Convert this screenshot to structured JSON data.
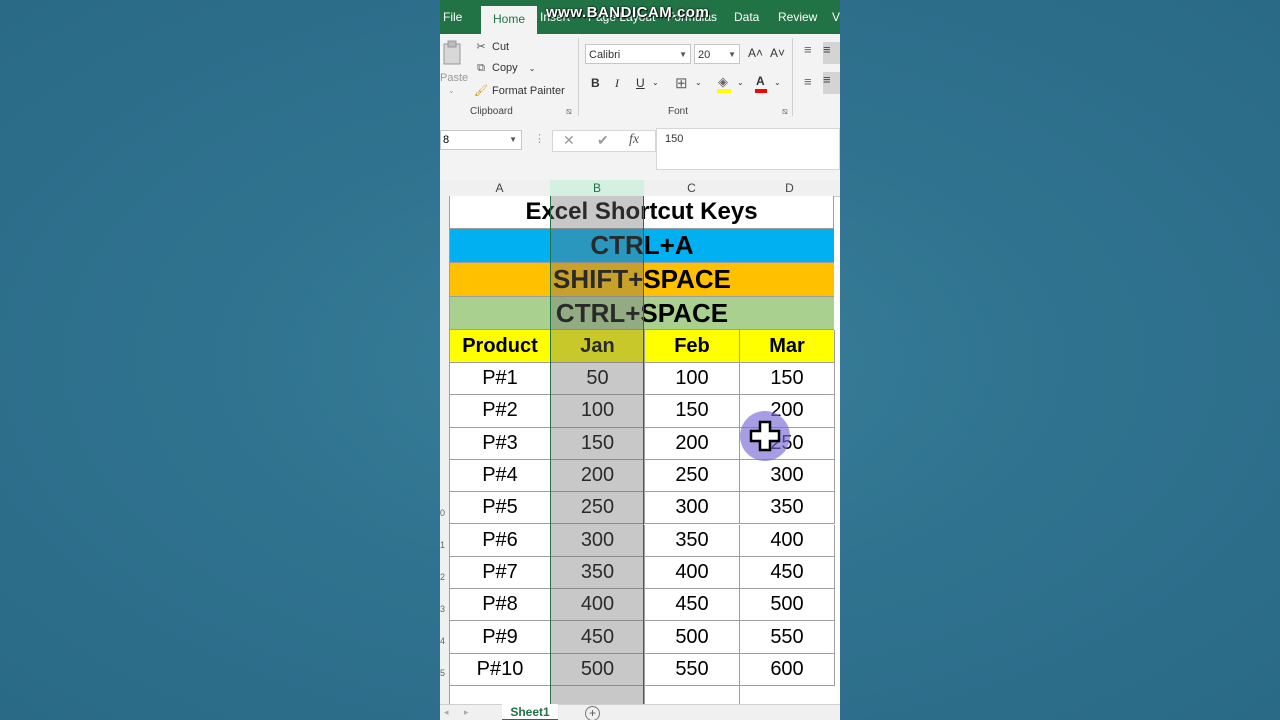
{
  "ribbon_tabs": [
    "File",
    "Home",
    "Insert",
    "Page Layout",
    "Formulas",
    "Data",
    "Review",
    "V"
  ],
  "active_tab": "Home",
  "watermark": "www.BANDICAM.com",
  "clipboard": {
    "paste": "Paste",
    "cut": "Cut",
    "copy": "Copy",
    "format_painter": "Format Painter",
    "group_label": "Clipboard"
  },
  "font": {
    "name": "Calibri",
    "size": "20",
    "grow": "A˄",
    "shrink": "A˅",
    "bold": "B",
    "italic": "I",
    "underline": "U",
    "font_color_glyph": "A",
    "group_label": "Font"
  },
  "formula_bar": {
    "name_box": "8",
    "cancel": "✕",
    "enter": "✔",
    "fx": "fx",
    "value": "150"
  },
  "columns": [
    "A",
    "B",
    "C",
    "D"
  ],
  "selected_column": "B",
  "row_numbers": [
    "",
    "",
    "",
    "",
    "",
    "",
    "",
    "",
    "",
    "",
    "0",
    "1",
    "2",
    "3",
    "4",
    "5"
  ],
  "sheet": {
    "title": "Excel Shortcut Keys",
    "shortcuts": [
      {
        "text": "CTRL+A",
        "color": "#00b0f0"
      },
      {
        "text": "SHIFT+SPACE",
        "color": "#ffc000"
      },
      {
        "text": "CTRL+SPACE",
        "color": "#a9d08e"
      }
    ],
    "header": [
      "Product",
      "Jan",
      "Feb",
      "Mar"
    ],
    "header_color": "#ffff00",
    "rows": [
      [
        "P#1",
        "50",
        "100",
        "150"
      ],
      [
        "P#2",
        "100",
        "150",
        "200"
      ],
      [
        "P#3",
        "150",
        "200",
        "250"
      ],
      [
        "P#4",
        "200",
        "250",
        "300"
      ],
      [
        "P#5",
        "250",
        "300",
        "350"
      ],
      [
        "P#6",
        "300",
        "350",
        "400"
      ],
      [
        "P#7",
        "350",
        "400",
        "450"
      ],
      [
        "P#8",
        "400",
        "450",
        "500"
      ],
      [
        "P#9",
        "450",
        "500",
        "550"
      ],
      [
        "P#10",
        "500",
        "550",
        "600"
      ]
    ]
  },
  "sheet_tabs": [
    "Sheet1"
  ],
  "icons": {
    "cursor": "excel-cross-cursor",
    "add_sheet": "plus-circle-icon"
  }
}
